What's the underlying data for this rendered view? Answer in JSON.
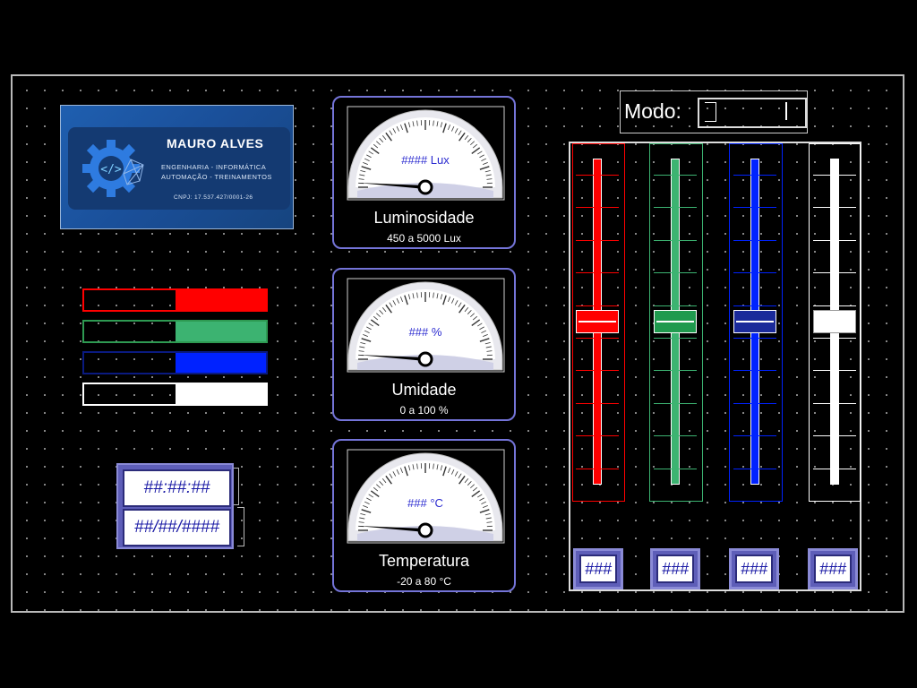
{
  "logo": {
    "name": "MAURO ALVES",
    "line1": "ENGENHARIA - INFORMÁTICA",
    "line2": "AUTOMAÇÃO - TREINAMENTOS",
    "line3": "CNPJ: 17.537.427/0001-26"
  },
  "color_bars": [
    {
      "color": "#ff0000",
      "level": 0.5
    },
    {
      "color": "#3cb371",
      "level": 0.5
    },
    {
      "color": "#0022ff",
      "level": 0.5
    },
    {
      "color": "#ffffff",
      "level": 0.5
    }
  ],
  "datetime": {
    "time": "##:##:##",
    "date": "##/##/####"
  },
  "gauges": [
    {
      "readout": "#### Lux",
      "title": "Luminosidade",
      "range": "450 a 5000 Lux"
    },
    {
      "readout": "### %",
      "title": "Umidade",
      "range": "0 a 100 %"
    },
    {
      "readout": "### °C",
      "title": "Temperatura",
      "range": "-20 a 80 °C"
    }
  ],
  "mode": {
    "label": "Modo:"
  },
  "sliders": [
    {
      "color": "#ff0000",
      "thumb": "#ff0000",
      "value_label": "###",
      "level": 0.5
    },
    {
      "color": "#3cb371",
      "thumb": "#1f9a4e",
      "value_label": "###",
      "level": 0.5
    },
    {
      "color": "#0022ff",
      "thumb": "#1a2a9a",
      "value_label": "###",
      "level": 0.5
    },
    {
      "color": "#ffffff",
      "thumb": "#ffffff",
      "value_label": "###",
      "level": 0.5
    }
  ]
}
